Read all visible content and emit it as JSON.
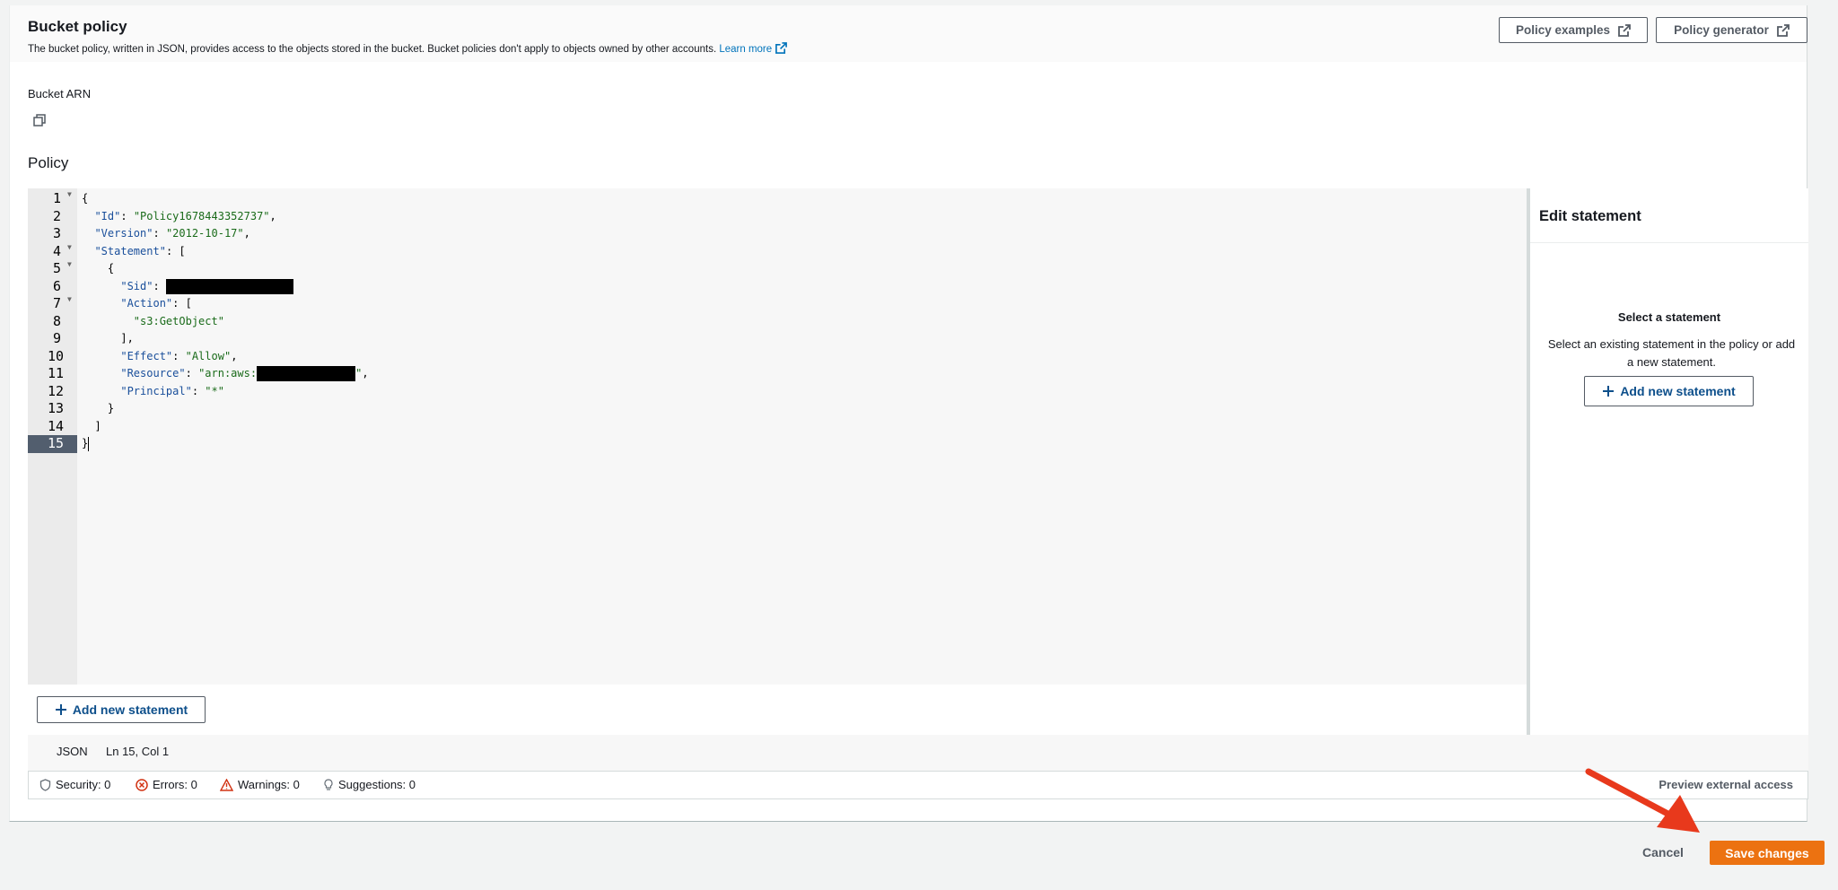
{
  "header": {
    "title": "Bucket policy",
    "description": "The bucket policy, written in JSON, provides access to the objects stored in the bucket. Bucket policies don't apply to objects owned by other accounts.",
    "learn_more": "Learn more",
    "policy_examples": "Policy examples",
    "policy_generator": "Policy generator"
  },
  "arn": {
    "label": "Bucket ARN"
  },
  "policy": {
    "label": "Policy"
  },
  "editor": {
    "line_numbers": [
      "1",
      "2",
      "3",
      "4",
      "5",
      "6",
      "7",
      "8",
      "9",
      "10",
      "11",
      "12",
      "13",
      "14",
      "15"
    ],
    "active_line": "15",
    "tokens": {
      "open_brace": "{",
      "id_key": "\"Id\"",
      "id_val": "\"Policy1678443352737\"",
      "version_key": "\"Version\"",
      "version_val": "\"2012-10-17\"",
      "statement_key": "\"Statement\"",
      "open_bracket": "[",
      "sid_key": "\"Sid\"",
      "action_key": "\"Action\"",
      "action_val": "\"s3:GetObject\"",
      "effect_key": "\"Effect\"",
      "effect_val": "\"Allow\"",
      "resource_key": "\"Resource\"",
      "resource_prefix": "\"arn:aws:",
      "resource_suffix": "\"",
      "principal_key": "\"Principal\"",
      "principal_val": "\"*\"",
      "close_brace": "}",
      "close_bracket": "]"
    }
  },
  "add_statement": {
    "label": "Add new statement"
  },
  "side_panel": {
    "title": "Edit statement",
    "subtitle": "Select a statement",
    "text": "Select an existing statement in the policy or add a new statement.",
    "add_label": "Add new statement"
  },
  "status": {
    "language": "JSON",
    "position": "Ln 15, Col 1",
    "security": "Security: 0",
    "errors": "Errors: 0",
    "warnings": "Warnings: 0",
    "suggestions": "Suggestions: 0",
    "preview": "Preview external access"
  },
  "footer": {
    "cancel": "Cancel",
    "save": "Save changes"
  },
  "colors": {
    "primary": "#ec7211",
    "link": "#0073bb",
    "annotation_arrow": "#e8391c",
    "active_line": "#525e6e"
  }
}
